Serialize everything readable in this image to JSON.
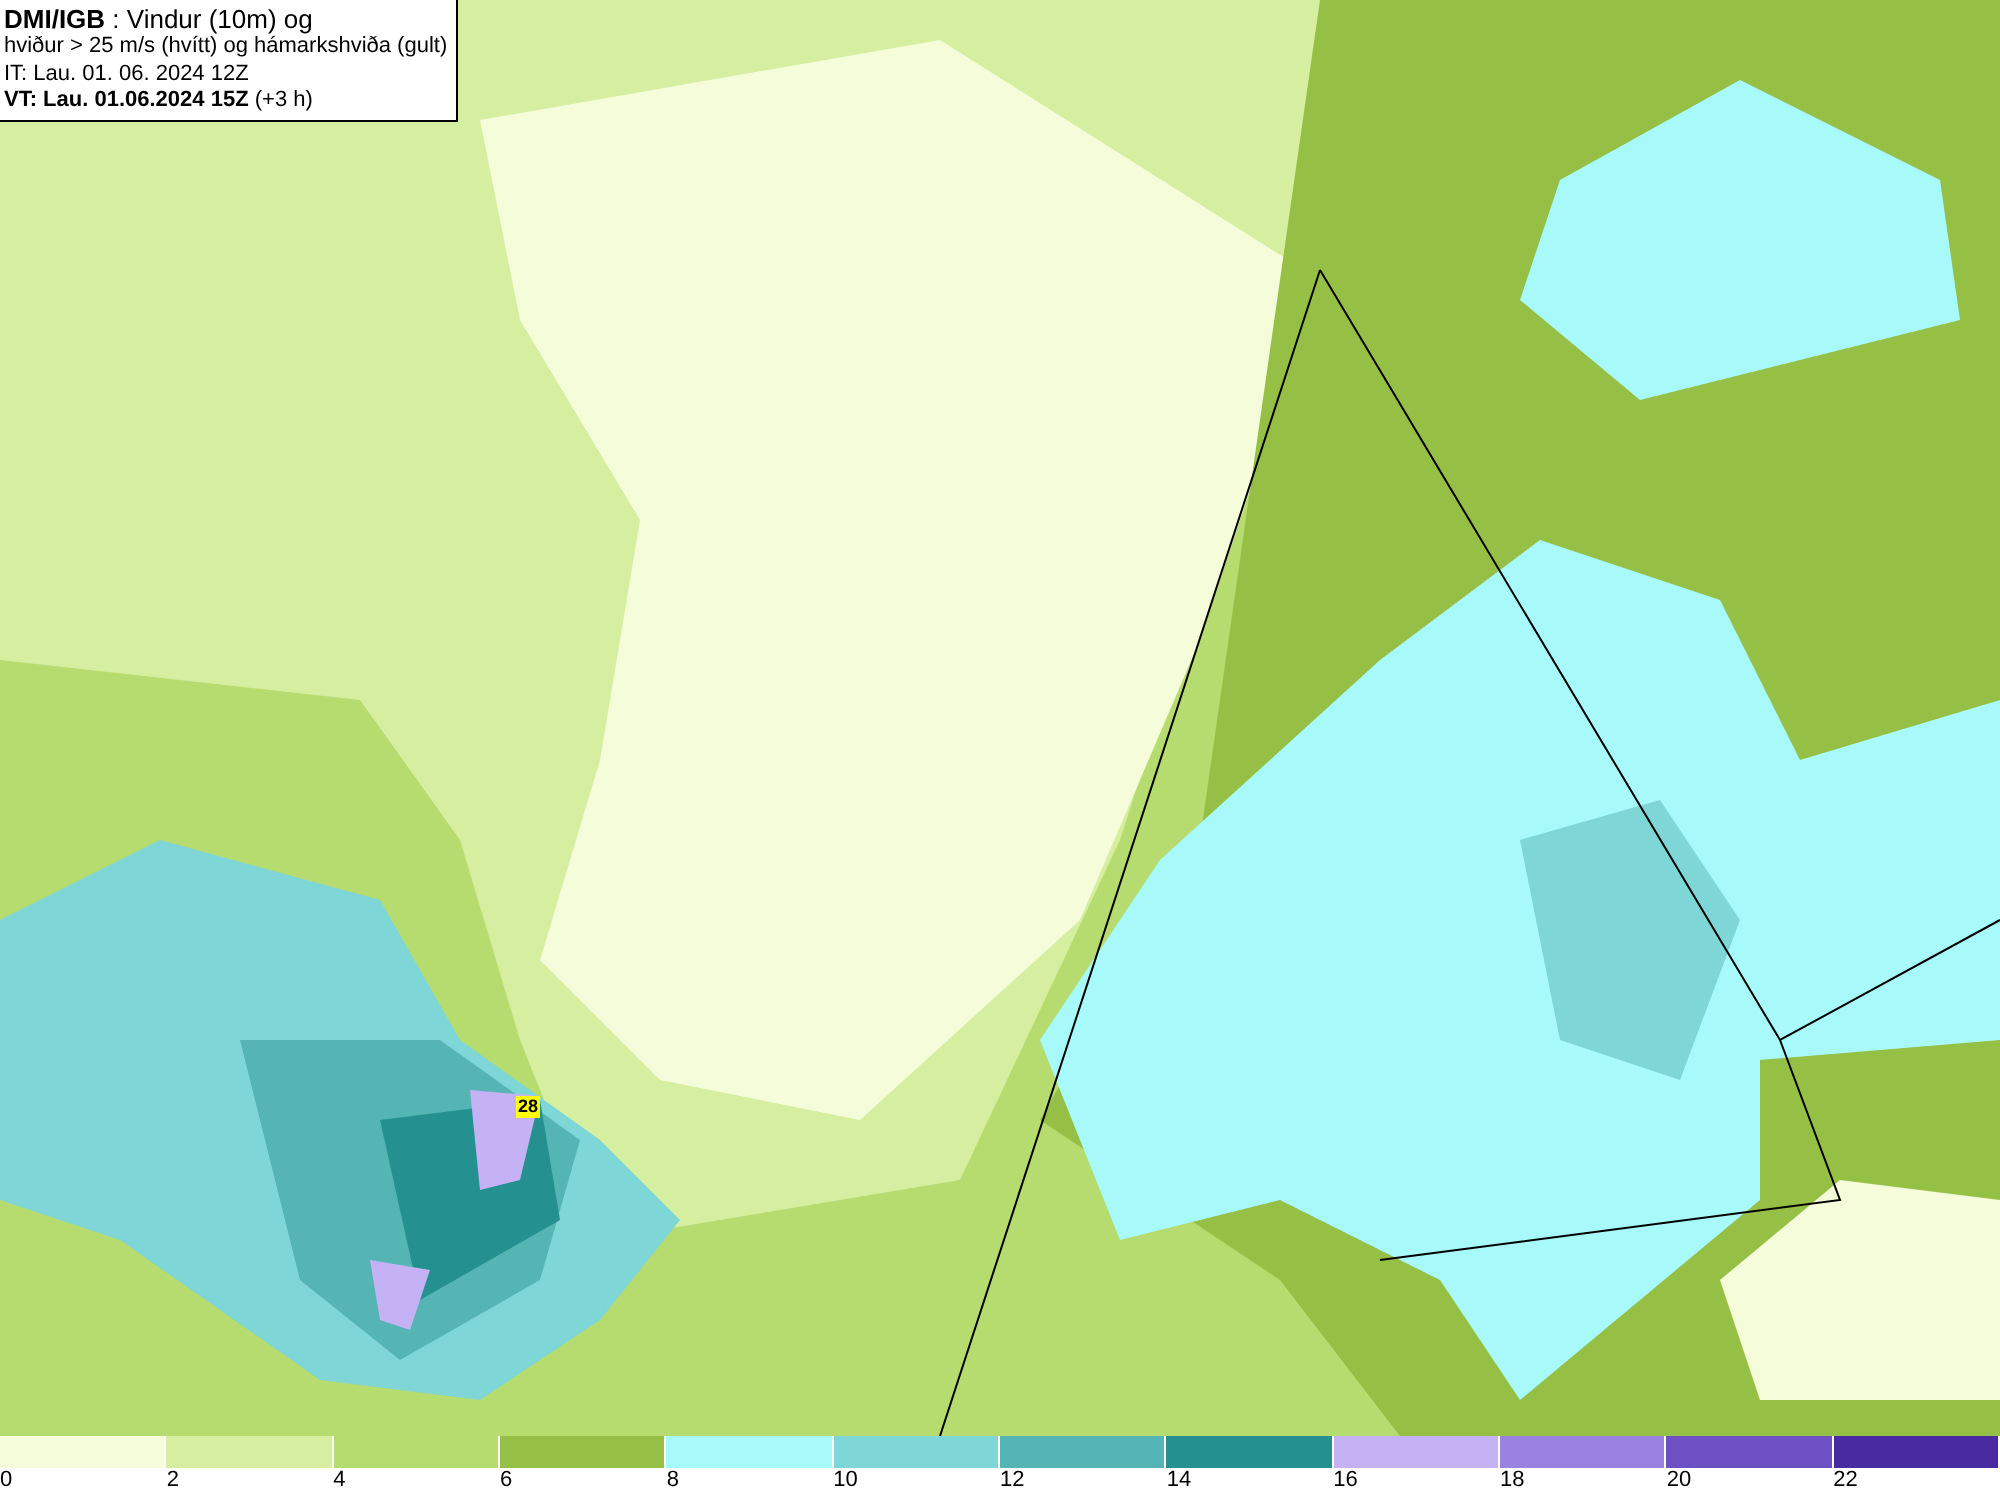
{
  "header": {
    "lines": [
      "**DMI/IGB** : Vindur (10m) og",
      "hviður > 25 m/s (hvítt) og hámarkshviða (gult)",
      "IT: Lau. 01. 06. 2024 12Z",
      "**VT: Lau. 01.06.2024 15Z** (+3 h)"
    ]
  },
  "map": {
    "gust_label": "28"
  },
  "legend": [
    {
      "label": "0",
      "color": "#f5fcd9"
    },
    {
      "label": "2",
      "color": "#d5eea0"
    },
    {
      "label": "4",
      "color": "#b6db6e"
    },
    {
      "label": "6",
      "color": "#96bf45"
    },
    {
      "label": "8",
      "color": "#a8fafa"
    },
    {
      "label": "10",
      "color": "#7fd6d6"
    },
    {
      "label": "12",
      "color": "#55b4b4"
    },
    {
      "label": "14",
      "color": "#259090"
    },
    {
      "label": "16",
      "color": "#c4b2f5"
    },
    {
      "label": "18",
      "color": "#9b82e0"
    },
    {
      "label": "20",
      "color": "#6e4fc4"
    },
    {
      "label": "22",
      "color": "#4a2aa0"
    }
  ]
}
